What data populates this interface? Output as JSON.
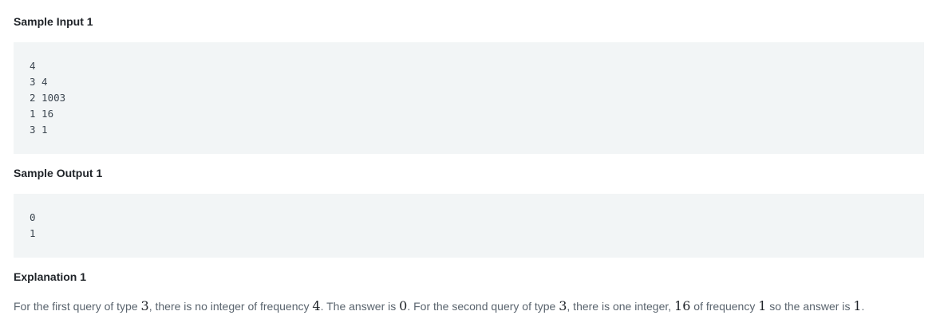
{
  "sample_input": {
    "heading": "Sample Input 1",
    "lines": [
      "4",
      "3 4",
      "2 1003",
      "1 16",
      "3 1"
    ]
  },
  "sample_output": {
    "heading": "Sample Output 1",
    "lines": [
      "0",
      "1"
    ]
  },
  "explanation": {
    "heading": "Explanation 1",
    "parts": [
      {
        "text": "For the first query of type ",
        "math": false
      },
      {
        "text": "3",
        "math": true
      },
      {
        "text": ", there is no integer of frequency ",
        "math": false
      },
      {
        "text": "4",
        "math": true
      },
      {
        "text": ". The answer is ",
        "math": false
      },
      {
        "text": "0",
        "math": true
      },
      {
        "text": ". For the second query of type ",
        "math": false
      },
      {
        "text": "3",
        "math": true
      },
      {
        "text": ", there is one integer, ",
        "math": false
      },
      {
        "text": "16",
        "math": true
      },
      {
        "text": " of frequency ",
        "math": false
      },
      {
        "text": "1",
        "math": true
      },
      {
        "text": " so the answer is ",
        "math": false
      },
      {
        "text": "1",
        "math": true
      },
      {
        "text": ".",
        "math": false
      }
    ]
  }
}
